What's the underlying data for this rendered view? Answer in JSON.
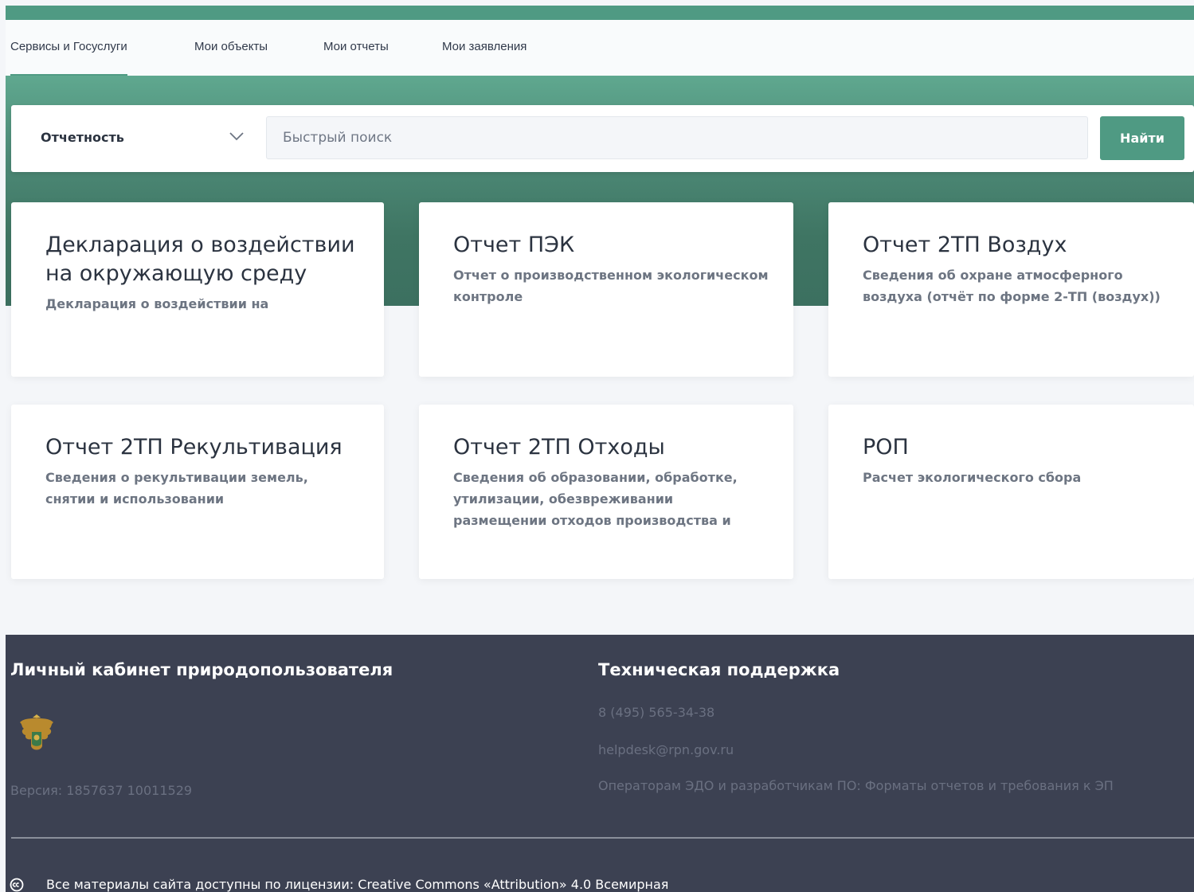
{
  "colors": {
    "accent": "#4f9a83",
    "hero_dark": "#3c7060",
    "footer_bg": "#3c4152",
    "text_dark": "#2b3340",
    "text_muted": "#6d7582"
  },
  "nav": {
    "tabs": [
      {
        "label": "Сервисы и Госуслуги",
        "active": true
      },
      {
        "label": "Мои объекты",
        "active": false
      },
      {
        "label": "Мои отчеты",
        "active": false
      },
      {
        "label": "Мои заявления",
        "active": false
      }
    ]
  },
  "search": {
    "category_label": "Отчетность",
    "category_icon": "chevron-down-icon",
    "placeholder": "Быстрый поиск",
    "button_label": "Найти"
  },
  "cards": [
    {
      "title": "Декларация о воздействии на окружающую среду",
      "description": "Декларация о воздействии на"
    },
    {
      "title": "Отчет ПЭК",
      "description": "Отчет о производственном экологическом контроле"
    },
    {
      "title": "Отчет 2ТП Воздух",
      "description": "Сведения об охране атмосферного воздуха (отчёт по форме 2-ТП (воздух))"
    },
    {
      "title": "Отчет 2ТП Рекультивация",
      "description": "Сведения о рекультивации земель, снятии и использовании"
    },
    {
      "title": "Отчет 2ТП Отходы",
      "description": "Сведения об образовании, обработке, утилизации, обезвреживании размещении отходов производства и"
    },
    {
      "title": "РОП",
      "description": "Расчет экологического сбора"
    }
  ],
  "footer": {
    "left_title": "Личный кабинет природопользователя",
    "emblem_icon": "emblem-icon",
    "version": "Версия: 1857637 10011529",
    "support_title": "Техническая поддержка",
    "phone": "8 (495) 565-34-38",
    "email": "helpdesk@rpn.gov.ru",
    "operators_link": "Операторам ЭДО и разработчикам ПО: Форматы отчетов и требования к ЭП",
    "license_icon": "creative-commons-icon",
    "license": "Все материалы сайта доступны по лицензии: Creative Commons «Attribution» 4.0 Всемирная"
  }
}
